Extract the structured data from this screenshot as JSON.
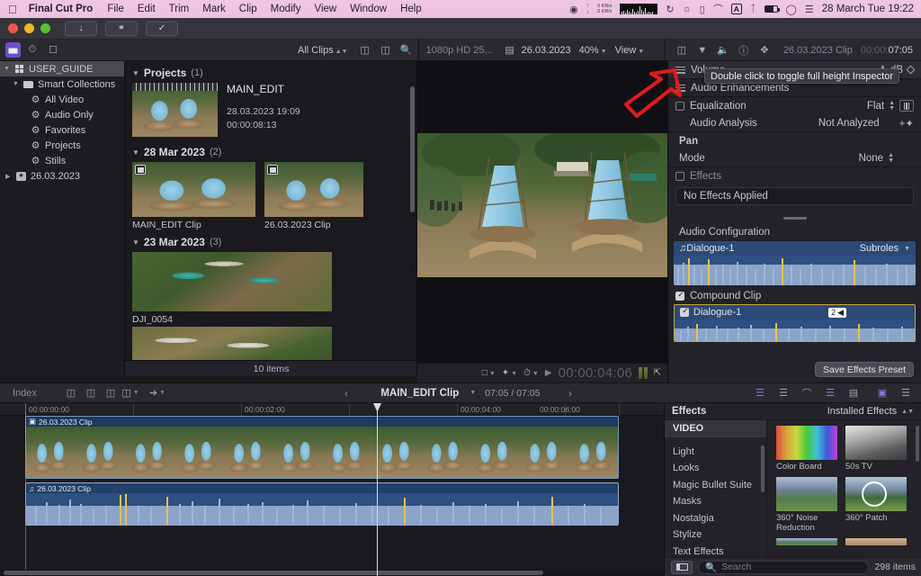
{
  "menubar": {
    "apple_icon": "apple-icon",
    "app_name": "Final Cut Pro",
    "items": [
      "File",
      "Edit",
      "Trim",
      "Mark",
      "Clip",
      "Modify",
      "View",
      "Window",
      "Help"
    ],
    "status": {
      "net_up": "0 KB/s",
      "net_down": "0 KB/s",
      "text_input_badge": "A",
      "clock": "28 March Tue  19:22"
    }
  },
  "toolbar": {
    "clip_filter": "All Clips",
    "project_format": "1080p HD 25...",
    "viewer_title": "26.03.2023",
    "zoom": "40%",
    "view_menu": "View",
    "inspector_title": "26.03.2023 Clip",
    "inspector_duration_dim": "00:00:",
    "inspector_duration_lit": "07:05"
  },
  "sidebar": {
    "library": "USER_GUIDE",
    "smart_collections": "Smart Collections",
    "items": [
      {
        "label": "All Video",
        "icon": "gear-icon"
      },
      {
        "label": "Audio Only",
        "icon": "gear-icon"
      },
      {
        "label": "Favorites",
        "icon": "gear-icon"
      },
      {
        "label": "Projects",
        "icon": "gear-icon"
      },
      {
        "label": "Stills",
        "icon": "gear-icon"
      }
    ],
    "event": "26.03.2023"
  },
  "browser": {
    "groups": [
      {
        "title": "Projects",
        "count": "(1)"
      },
      {
        "title": "28 Mar 2023",
        "count": "(2)"
      },
      {
        "title": "23 Mar 2023",
        "count": "(3)"
      }
    ],
    "project": {
      "name": "MAIN_EDIT",
      "date": "28.03.2023 19:09",
      "duration": "00:00:08:13"
    },
    "clips": [
      {
        "name": "MAIN_EDIT Clip"
      },
      {
        "name": "26.03.2023 Clip"
      },
      {
        "name": "DJI_0054"
      }
    ],
    "item_count": "10 items"
  },
  "viewer": {
    "timecode": "00:00:04:06",
    "play_icon": "play-icon",
    "crop_icon": "crop-icon",
    "effects_icon": "magic-wand-icon",
    "retime_icon": "speedometer-icon",
    "fullscreen_icon": "fullscreen-icon"
  },
  "inspector": {
    "tooltip": "Double click to toggle full height Inspector",
    "rows": [
      {
        "label": "Volume",
        "value": "",
        "unit": "dB"
      },
      {
        "label": "Audio Enhancements"
      },
      {
        "label": "Equalization",
        "value": "Flat"
      },
      {
        "label": "Audio Analysis",
        "value": "Not Analyzed"
      },
      {
        "label": "Pan"
      },
      {
        "label": "Mode",
        "value": "None"
      },
      {
        "label": "Effects"
      }
    ],
    "no_effects": "No Effects Applied",
    "audio_configuration": "Audio Configuration",
    "dialogue_main": "Dialogue-1",
    "subroles": "Subroles",
    "compound_clip": "Compound Clip",
    "dialogue_sub": "Dialogue-1",
    "channel_badge": "2",
    "save_preset": "Save Effects Preset"
  },
  "timeline_toolbar": {
    "index": "Index",
    "project": "MAIN_EDIT Clip",
    "duration": "07:05 / 07:05",
    "back_arrow": "‹",
    "forward_arrow": "›"
  },
  "timeline": {
    "ruler_labels": [
      "00:00:00:00",
      "00:00:02:00",
      "00:00:04:00",
      "00:00:06:00"
    ],
    "video_clip": "26.03.2023 Clip",
    "audio_clip": "26.03.2023 Clip"
  },
  "effects": {
    "title": "Effects",
    "installed": "Installed Effects",
    "categories": [
      "VIDEO",
      "Light",
      "Looks",
      "Magic Bullet Suite",
      "Masks",
      "Nostalgia",
      "Stylize",
      "Text Effects"
    ],
    "items": [
      {
        "name": "Color Board",
        "thumb": "colorbar"
      },
      {
        "name": "50s TV",
        "thumb": "tv50s"
      },
      {
        "name": "360° Noise Reduction",
        "thumb": "mountain"
      },
      {
        "name": "360° Patch",
        "thumb": "mountain-circle"
      }
    ],
    "search_placeholder": "Search",
    "count": "298 items"
  },
  "colors": {
    "accent_purple": "#6c50c8",
    "annotation_red": "#e01b1b",
    "selection_blue": "#2e4f80",
    "highlight_yellow": "#c2a93c"
  }
}
